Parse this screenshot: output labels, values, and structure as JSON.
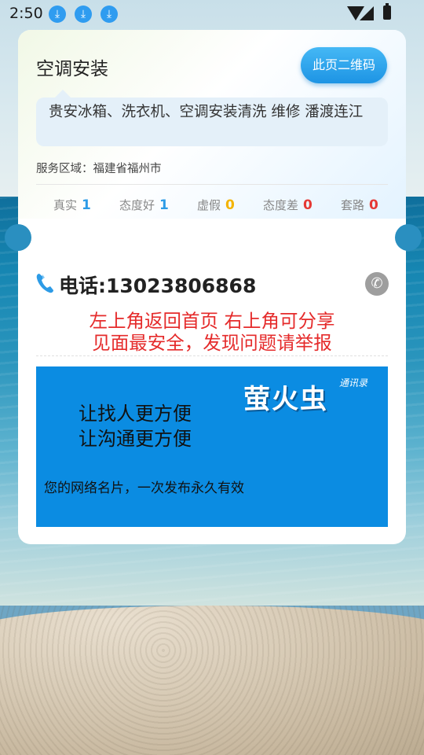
{
  "status_bar": {
    "time": "2:50",
    "download_icons": [
      "download-icon",
      "download-icon",
      "download-icon"
    ]
  },
  "listing": {
    "title": "空调安装",
    "qr_button_label": "此页二维码",
    "description": "贵安冰箱、洗衣机、空调安装清洗 维修 潘渡连江",
    "service_area": "服务区域：福建省福州市"
  },
  "stats": [
    {
      "label": "真实",
      "value": "1",
      "color": "blue"
    },
    {
      "label": "态度好",
      "value": "1",
      "color": "blue"
    },
    {
      "label": "虚假",
      "value": "0",
      "color": "yellow"
    },
    {
      "label": "态度差",
      "value": "0",
      "color": "red"
    },
    {
      "label": "套路",
      "value": "0",
      "color": "red"
    }
  ],
  "contact": {
    "phone_text": "电话:13023806868"
  },
  "notice": {
    "line1": "左上角返回首页 右上角可分享",
    "line2": "见面最安全，发现问题请举报"
  },
  "banner": {
    "line1": "让找人更方便",
    "line2": "让沟通更方便",
    "tagline": "您的网络名片，一次发布永久有效",
    "brand": "萤火虫",
    "brand_sub": "通讯录"
  },
  "colors": {
    "accent": "#2d9be6",
    "warning": "#e52b2b",
    "banner": "#0b8ce2"
  }
}
